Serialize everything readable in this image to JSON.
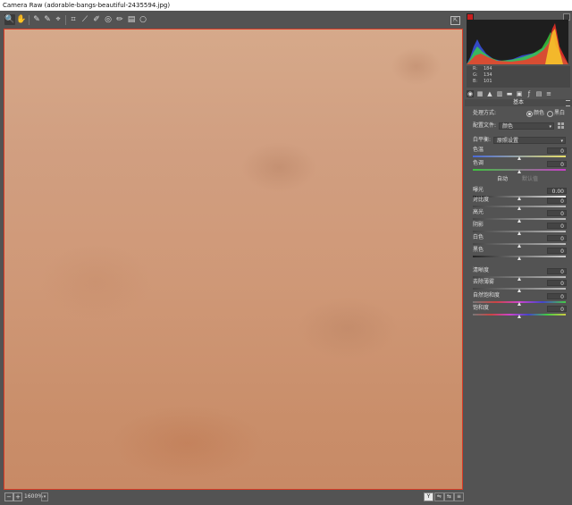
{
  "window": {
    "title": "Camera Raw (adorable-bangs-beautiful-2435594.jpg)"
  },
  "toolbar": {
    "tools": [
      {
        "icon": "zoom-icon",
        "glyph": "🔍"
      },
      {
        "icon": "hand-icon",
        "glyph": "✋"
      },
      {
        "icon": "white-balance-icon",
        "glyph": "✎"
      },
      {
        "icon": "color-sampler-icon",
        "glyph": "✎"
      },
      {
        "icon": "targeted-adjustment-icon",
        "glyph": "⌖"
      },
      {
        "icon": "crop-icon",
        "glyph": "⌗"
      },
      {
        "icon": "straighten-icon",
        "glyph": "⟋"
      },
      {
        "icon": "spot-removal-icon",
        "glyph": "✐"
      },
      {
        "icon": "red-eye-icon",
        "glyph": "◎"
      },
      {
        "icon": "adjustment-brush-icon",
        "glyph": "✏"
      },
      {
        "icon": "graduated-filter-icon",
        "glyph": "▤"
      },
      {
        "icon": "radial-filter-icon",
        "glyph": "○"
      }
    ],
    "fullscreen_icon": "fullscreen-icon"
  },
  "statusbar": {
    "zoom": "1600%",
    "zoom_dropdown": "▾",
    "minus": "−",
    "plus": "+",
    "view_buttons": [
      "Y",
      "⇋",
      "⇆",
      "≡"
    ]
  },
  "colors": {
    "accent_red": "#d93b26",
    "panel": "#535353",
    "skin": "#cf9877"
  },
  "histogram": {
    "r_label": "R:",
    "r_value": "184",
    "g_label": "G:",
    "g_value": "134",
    "b_label": "B:",
    "b_value": "101"
  },
  "panel_tabs": [
    "basic-icon",
    "tone-curve-icon",
    "detail-icon",
    "hsl-icon",
    "split-toning-icon",
    "lens-icon",
    "effects-icon",
    "calibration-icon",
    "presets-icon"
  ],
  "basic": {
    "section_title": "基本",
    "treatment_label": "处理方式:",
    "treatment_color": "颜色",
    "treatment_bw": "黑白",
    "profile_label": "配置文件:",
    "profile_value": "颜色",
    "wb_label": "白平衡:",
    "wb_value": "原照设置",
    "auto": "自动",
    "default": "默认值",
    "sliders": [
      {
        "label": "色温",
        "value": "0",
        "pos": 0.5
      },
      {
        "label": "色调",
        "value": "0",
        "pos": 0.5
      },
      {
        "label": "曝光",
        "value": "0.00",
        "pos": 0.5
      },
      {
        "label": "对比度",
        "value": "0",
        "pos": 0.5
      },
      {
        "label": "高光",
        "value": "0",
        "pos": 0.5
      },
      {
        "label": "阴影",
        "value": "0",
        "pos": 0.5
      },
      {
        "label": "白色",
        "value": "0",
        "pos": 0.5
      },
      {
        "label": "黑色",
        "value": "0",
        "pos": 0.5
      },
      {
        "label": "清晰度",
        "value": "0",
        "pos": 0.5
      },
      {
        "label": "去除薄雾",
        "value": "0",
        "pos": 0.5
      },
      {
        "label": "自然饱和度",
        "value": "0",
        "pos": 0.5
      },
      {
        "label": "饱和度",
        "value": "0",
        "pos": 0.5
      }
    ]
  }
}
